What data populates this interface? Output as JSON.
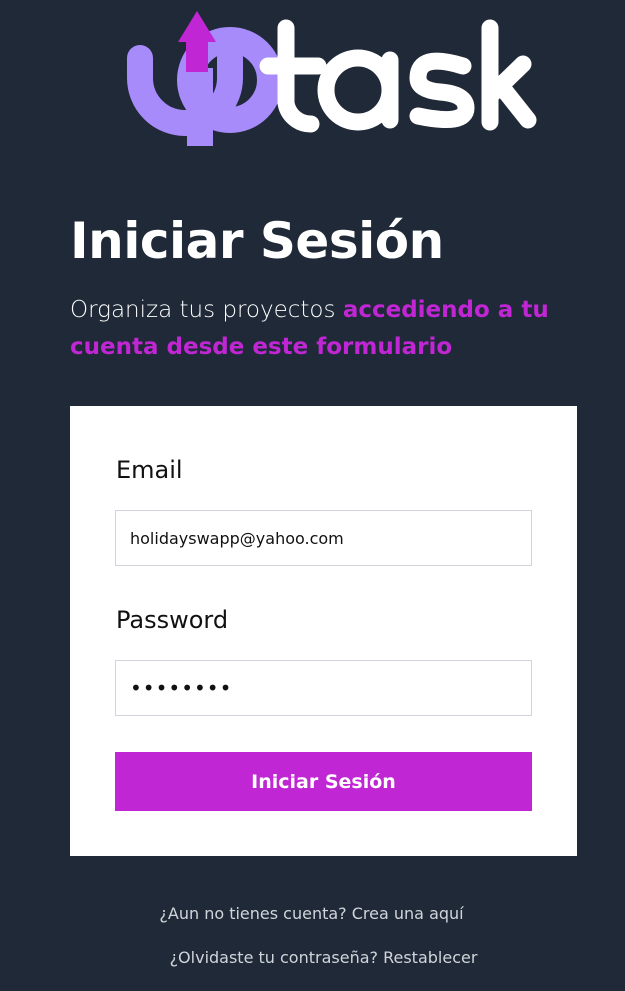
{
  "brand": {
    "logo_text": "uptask",
    "colors": {
      "logo_purple": "#a78bfa",
      "arrow_magenta": "#c026d3",
      "text_white": "#ffffff"
    }
  },
  "login": {
    "heading": "Iniciar Sesión",
    "subtitle_plain": "Organiza tus proyectos ",
    "subtitle_accent": "accediendo a tu cuenta desde este formulario"
  },
  "form": {
    "email_label": "Email",
    "email_value": "holidayswapp@yahoo.com",
    "password_label": "Password",
    "password_value": "••••••••",
    "submit_label": "Iniciar Sesión"
  },
  "links": {
    "register": "¿Aun no tienes cuenta? Crea una aquí",
    "forgot": "¿Olvidaste tu contraseña? Restablecer"
  },
  "colors": {
    "background": "#1f2937",
    "accent": "#c026d3",
    "card": "#ffffff"
  }
}
